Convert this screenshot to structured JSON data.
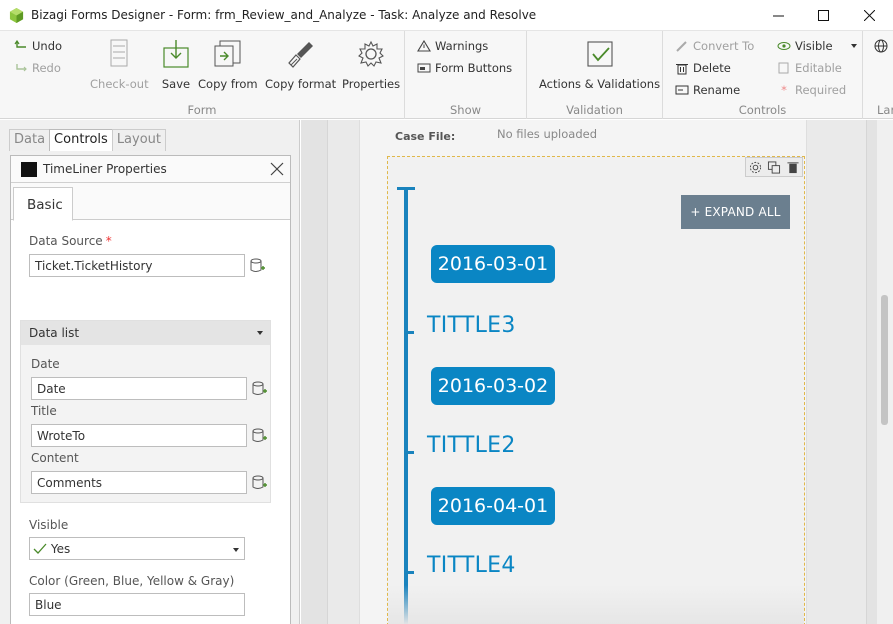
{
  "window": {
    "title": "Bizagi Forms Designer  - Form: frm_Review_and_Analyze - Task:  Analyze and Resolve"
  },
  "ribbon": {
    "undo": "Undo",
    "redo": "Redo",
    "checkout": "Check-out",
    "save": "Save",
    "copy_from": "Copy from",
    "copy_format": "Copy format",
    "properties": "Properties",
    "form_group": "Form",
    "warnings": "Warnings",
    "form_buttons": "Form Buttons",
    "show_group": "Show",
    "actions_validations": "Actions & Validations",
    "validation_group": "Validation",
    "convert_to": "Convert To",
    "delete": "Delete",
    "rename": "Rename",
    "visible": "Visible",
    "editable": "Editable",
    "required": "Required",
    "controls_group": "Controls",
    "lang_group": "Lar"
  },
  "panel_tabs": [
    "Data",
    "Controls",
    "Layout"
  ],
  "properties": {
    "header": "TimeLiner Properties",
    "tab_basic": "Basic",
    "data_source_label": "Data Source",
    "data_source_required": "*",
    "data_source_value": "Ticket.TicketHistory",
    "data_list_label": "Data list",
    "date_label": "Date",
    "date_value": "Date",
    "title_label": "Title",
    "title_value": "WroteTo",
    "content_label": "Content",
    "content_value": "Comments",
    "visible_label": "Visible",
    "visible_value": "Yes",
    "color_label": "Color (Green, Blue, Yellow & Gray)",
    "color_value": "Blue"
  },
  "canvas": {
    "case_file_label": "Case File:",
    "case_file_value": "No files uploaded",
    "expand_all": "+ EXPAND ALL",
    "timeline": [
      {
        "date": "2016-03-01",
        "title": "TITTLE3"
      },
      {
        "date": "2016-03-02",
        "title": "TITTLE2"
      },
      {
        "date": "2016-04-01",
        "title": "TITTLE4"
      }
    ]
  },
  "colors": {
    "timeline_blue": "#0a86c4",
    "expand_button": "#6b7f8f",
    "required_red": "#e33333"
  }
}
